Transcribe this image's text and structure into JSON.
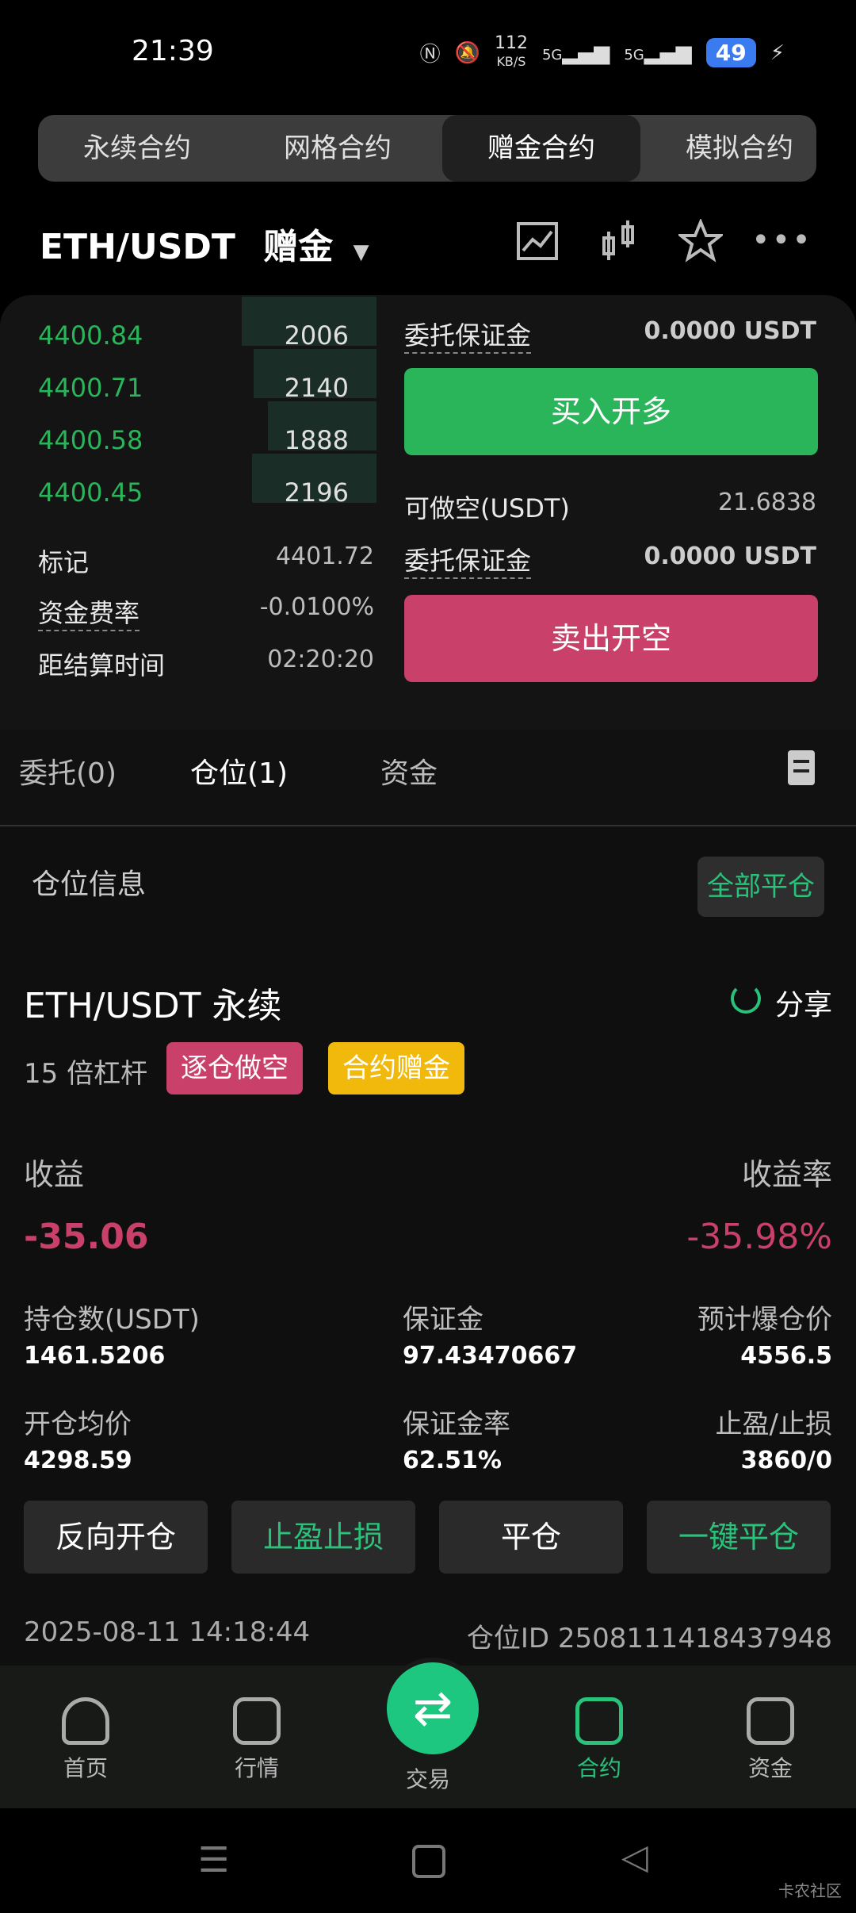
{
  "status": {
    "time": "21:39",
    "net_speed": "112",
    "net_unit": "KB/S",
    "sig1": "5G",
    "sig2": "5G",
    "battery": "49"
  },
  "tabs": [
    {
      "label": "永续合约"
    },
    {
      "label": "网格合约"
    },
    {
      "label": "赠金合约"
    },
    {
      "label": "模拟合约"
    }
  ],
  "pair": {
    "name": "ETH/USDT",
    "mode": "赠金"
  },
  "orderbook": [
    {
      "price": "4400.84",
      "qty": "2006"
    },
    {
      "price": "4400.71",
      "qty": "2140"
    },
    {
      "price": "4400.58",
      "qty": "1888"
    },
    {
      "price": "4400.45",
      "qty": "2196"
    }
  ],
  "market": {
    "mark_label": "标记",
    "mark_value": "4401.72",
    "funding_label": "资金费率",
    "funding_value": "-0.0100%",
    "settle_label": "距结算时间",
    "settle_value": "02:20:20"
  },
  "order": {
    "margin_label": "委托保证金",
    "margin_value": "0.0000 USDT",
    "buy_label": "买入开多",
    "short_label": "可做空(USDT)",
    "short_value": "21.6838",
    "margin2_label": "委托保证金",
    "margin2_value": "0.0000 USDT",
    "sell_label": "卖出开空"
  },
  "ptabs": {
    "orders": "委托(0)",
    "positions": "仓位(1)",
    "funds": "资金"
  },
  "position": {
    "section": "仓位信息",
    "close_all": "全部平仓",
    "title": "ETH/USDT 永续",
    "share": "分享",
    "leverage": "15 倍杠杆",
    "tag1": "逐仓做空",
    "tag2": "合约赠金",
    "pnl_label": "收益",
    "pnl_value": "-35.06",
    "roi_label": "收益率",
    "roi_value": "-35.98%",
    "size_label": "持仓数(USDT)",
    "size_value": "1461.5206",
    "margin_label": "保证金",
    "margin_value": "97.43470667",
    "liq_label": "预计爆仓价",
    "liq_value": "4556.5",
    "entry_label": "开仓均价",
    "entry_value": "4298.59",
    "mratio_label": "保证金率",
    "mratio_value": "62.51%",
    "tpsl_label": "止盈/止损",
    "tpsl_value": "3860/0",
    "btn_reverse": "反向开仓",
    "btn_tpsl": "止盈止损",
    "btn_close": "平仓",
    "btn_quick": "一键平仓",
    "time": "2025-08-11 14:18:44",
    "id_label": "仓位ID 2508111418437948"
  },
  "nav": [
    {
      "label": "首页"
    },
    {
      "label": "行情"
    },
    {
      "label": "交易"
    },
    {
      "label": "合约"
    },
    {
      "label": "资金"
    }
  ],
  "watermark": "卡农社区",
  "colors": {
    "green": "#2bb55a",
    "red": "#c9406a",
    "teal": "#29c27b",
    "yellow": "#f0b90b"
  }
}
